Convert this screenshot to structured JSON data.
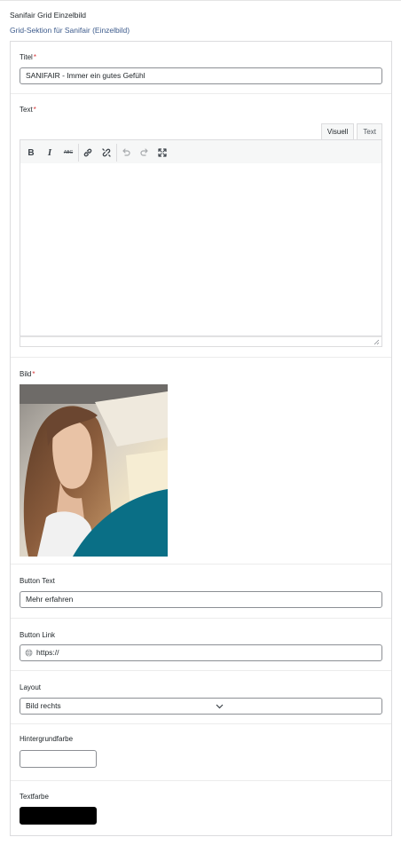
{
  "header": {
    "title": "Sanifair Grid Einzelbild",
    "subtitle": "Grid-Sektion für Sanifair (Einzelbild)"
  },
  "fields": {
    "titel": {
      "label": "Titel",
      "required": "*",
      "value": "SANIFAIR - Immer ein gutes Gefühl"
    },
    "text": {
      "label": "Text",
      "required": "*",
      "tabs": [
        "Visuell",
        "Text"
      ],
      "toolbar": [
        "bold-icon",
        "italic-icon",
        "strikethrough-icon",
        "link-icon",
        "unlink-icon",
        "undo-icon",
        "redo-icon",
        "fullscreen-icon"
      ],
      "bold_glyph": "B",
      "italic_glyph": "I",
      "strike_glyph": "ABC"
    },
    "bild": {
      "label": "Bild",
      "required": "*",
      "colors": {
        "teal": "#0a6f86"
      }
    },
    "button_text": {
      "label": "Button Text",
      "value": "Mehr erfahren"
    },
    "button_link": {
      "label": "Button Link",
      "value": "https://"
    },
    "layout": {
      "label": "Layout",
      "selected": "Bild rechts"
    },
    "hintergrundfarbe": {
      "label": "Hintergrundfarbe",
      "color": "#ffffff"
    },
    "textfarbe": {
      "label": "Textfarbe",
      "color": "#000000"
    }
  }
}
